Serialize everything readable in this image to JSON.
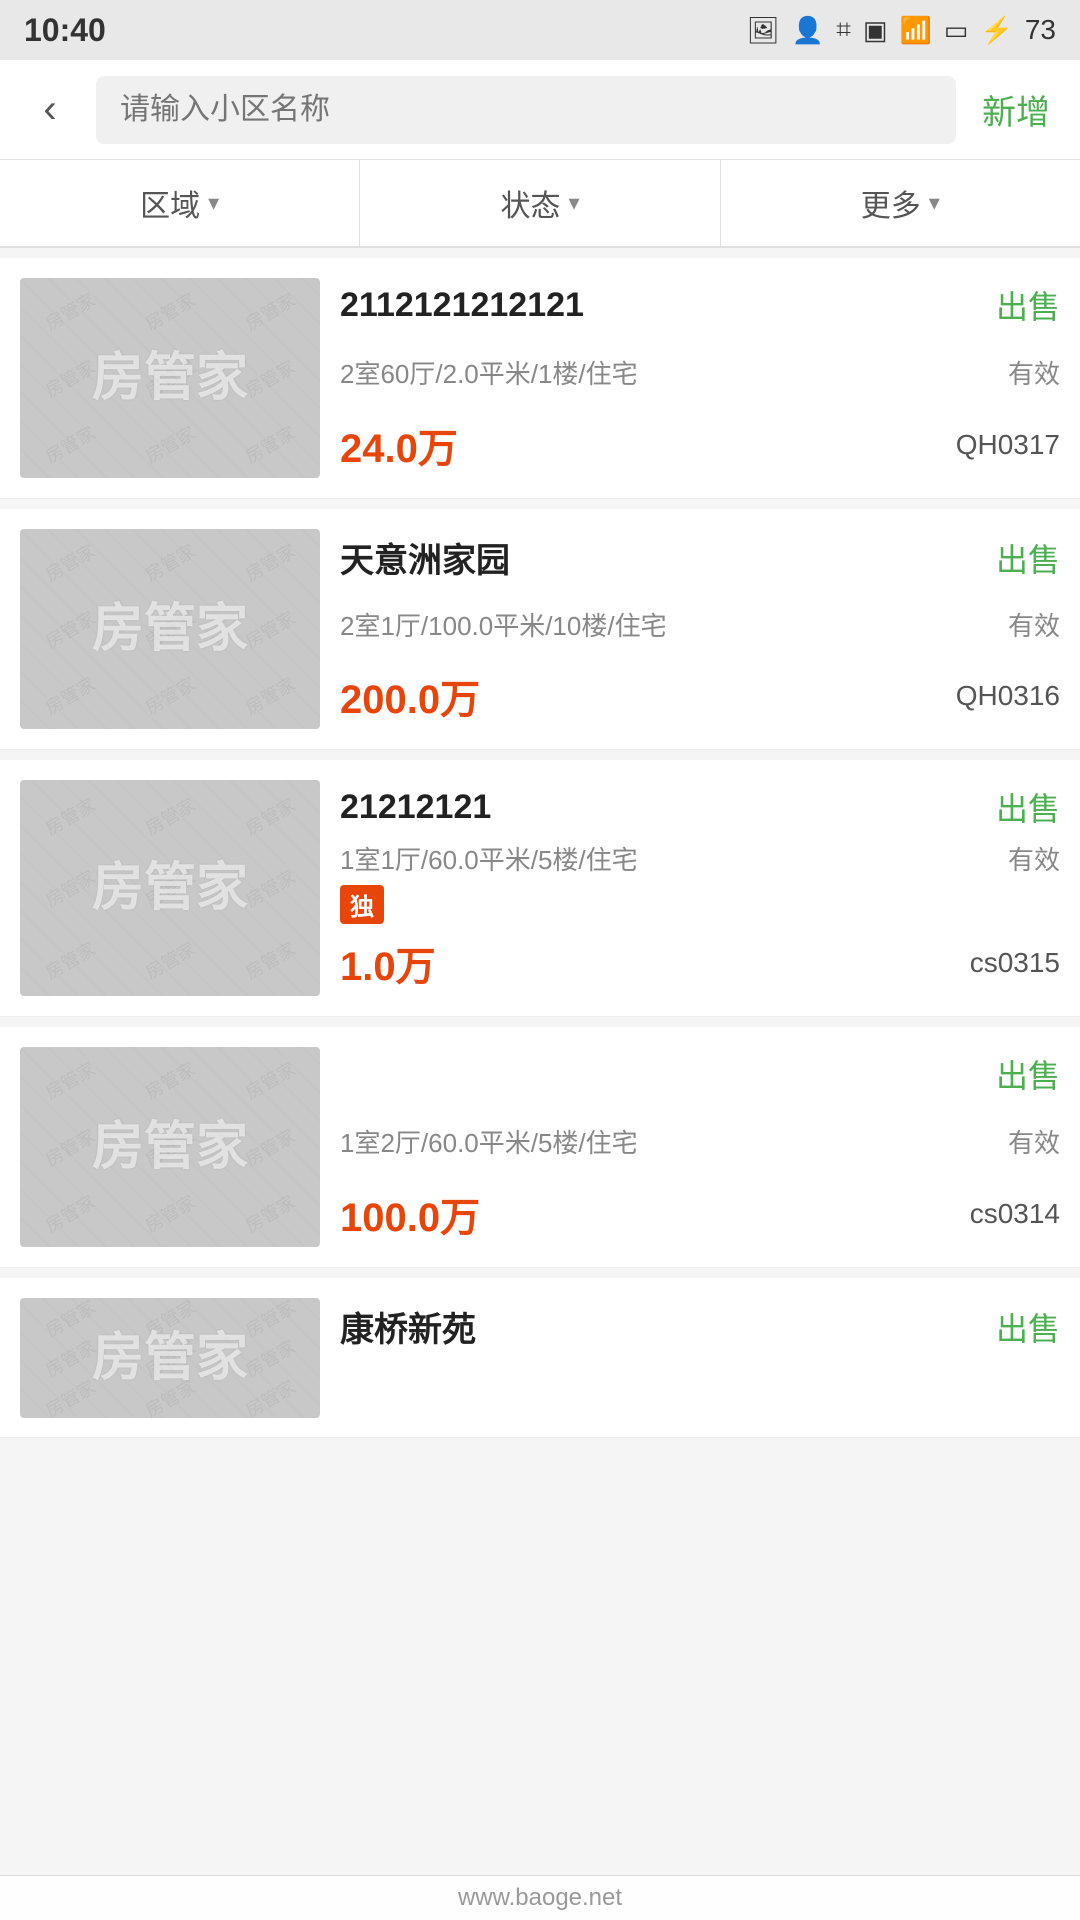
{
  "status_bar": {
    "time": "10:40",
    "battery": "73"
  },
  "header": {
    "back_label": "‹",
    "search_placeholder": "请输入小区名称",
    "new_label": "新增"
  },
  "filters": [
    {
      "id": "area",
      "label": "区域"
    },
    {
      "id": "status",
      "label": "状态"
    },
    {
      "id": "more",
      "label": "更多"
    }
  ],
  "listings": [
    {
      "id": "1",
      "thumb_text": "房管家",
      "title": "2112121212121",
      "sale_status": "出售",
      "meta": "2室60厅/2.0平米/1楼/住宅",
      "valid": "有效",
      "price": "24.0万",
      "code": "QH0317",
      "tag": null,
      "visible": true
    },
    {
      "id": "2",
      "thumb_text": "房管家",
      "title": "天意洲家园",
      "sale_status": "出售",
      "meta": "2室1厅/100.0平米/10楼/住宅",
      "valid": "有效",
      "price": "200.0万",
      "code": "QH0316",
      "tag": null,
      "visible": true
    },
    {
      "id": "3",
      "thumb_text": "房管家",
      "title": "21212121",
      "sale_status": "出售",
      "meta": "1室1厅/60.0平米/5楼/住宅",
      "valid": "有效",
      "price": "1.0万",
      "code": "cs0315",
      "tag": "独",
      "visible": true
    },
    {
      "id": "4",
      "thumb_text": "房管家",
      "title": "",
      "sale_status": "出售",
      "meta": "1室2厅/60.0平米/5楼/住宅",
      "valid": "有效",
      "price": "100.0万",
      "code": "cs0314",
      "tag": null,
      "visible": true
    },
    {
      "id": "5",
      "thumb_text": "房管家",
      "title": "康桥新苑",
      "sale_status": "出售",
      "meta": "",
      "valid": "",
      "price": "",
      "code": "",
      "tag": null,
      "visible": "partial"
    }
  ],
  "watermark_texts": [
    "房管家",
    "房管家",
    "房管家",
    "房管家",
    "房管家",
    "房管家",
    "房管家",
    "房管家",
    "房管家"
  ],
  "bottom_watermark": "www.baoge.net"
}
